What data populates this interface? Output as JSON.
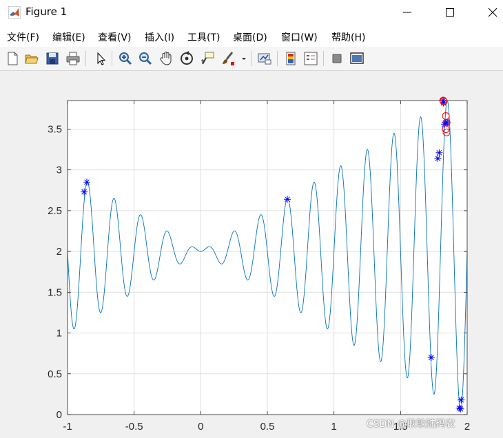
{
  "window": {
    "title": "Figure 1",
    "controls": [
      "minimize",
      "maximize",
      "close"
    ]
  },
  "menu": {
    "items": [
      {
        "label": "文件(F)"
      },
      {
        "label": "编辑(E)"
      },
      {
        "label": "查看(V)"
      },
      {
        "label": "插入(I)"
      },
      {
        "label": "工具(T)"
      },
      {
        "label": "桌面(D)"
      },
      {
        "label": "窗口(W)"
      },
      {
        "label": "帮助(H)"
      }
    ]
  },
  "toolbar": {
    "buttons": [
      {
        "name": "new-figure-icon"
      },
      {
        "name": "open-file-icon"
      },
      {
        "name": "save-icon"
      },
      {
        "name": "print-icon"
      },
      {
        "name": "edit-plot-pointer-icon"
      },
      {
        "name": "zoom-in-icon"
      },
      {
        "name": "zoom-out-icon"
      },
      {
        "name": "pan-hand-icon"
      },
      {
        "name": "rotate-3d-icon"
      },
      {
        "name": "data-cursor-icon"
      },
      {
        "name": "brush-icon"
      },
      {
        "name": "link-plot-icon"
      },
      {
        "name": "insert-colorbar-icon"
      },
      {
        "name": "insert-legend-icon"
      },
      {
        "name": "hide-plot-tools-icon"
      },
      {
        "name": "show-plot-tools-icon"
      }
    ]
  },
  "watermark": "CSDN @耿耿陆码农",
  "chart_data": {
    "type": "line",
    "function": "x*sin(10*pi*x) + 2",
    "xlim": [
      -1,
      2
    ],
    "ylim": [
      0,
      3.85
    ],
    "xticks": [
      -1,
      -0.5,
      0,
      0.5,
      1,
      1.5,
      2
    ],
    "yticks": [
      0,
      0.5,
      1,
      1.5,
      2,
      2.5,
      3,
      3.5
    ],
    "xtick_labels": [
      "-1",
      "-0.5",
      "0",
      "0.5",
      "1",
      "1.5",
      "2"
    ],
    "ytick_labels": [
      "0",
      "0.5",
      "1",
      "1.5",
      "2",
      "2.5",
      "3",
      "3.5"
    ],
    "grid": true,
    "colors": {
      "curve": "#0072bd",
      "population": "#0000ff",
      "best": "#ff0000",
      "axis": "#262626",
      "grid": "#dfdfdf"
    },
    "series": [
      {
        "marker": "*",
        "color": "#0000ff",
        "points": [
          [
            -0.875,
            2.73
          ],
          [
            -0.855,
            2.85
          ],
          [
            0.65,
            2.64
          ],
          [
            1.73,
            0.7
          ],
          [
            1.78,
            3.14
          ],
          [
            1.79,
            3.21
          ],
          [
            1.83,
            3.56
          ],
          [
            1.84,
            3.58
          ],
          [
            1.85,
            3.58
          ],
          [
            1.94,
            0.08
          ],
          [
            1.955,
            0.18
          ],
          [
            1.95,
            0.07
          ],
          [
            1.82,
            3.85
          ],
          [
            1.822,
            3.82
          ]
        ]
      },
      {
        "marker": "o",
        "color": "#ff0000",
        "points": [
          [
            1.82,
            3.85
          ],
          [
            1.823,
            3.84
          ],
          [
            1.84,
            3.66
          ],
          [
            1.845,
            3.58
          ],
          [
            1.84,
            3.5
          ],
          [
            1.845,
            3.46
          ]
        ]
      }
    ]
  }
}
